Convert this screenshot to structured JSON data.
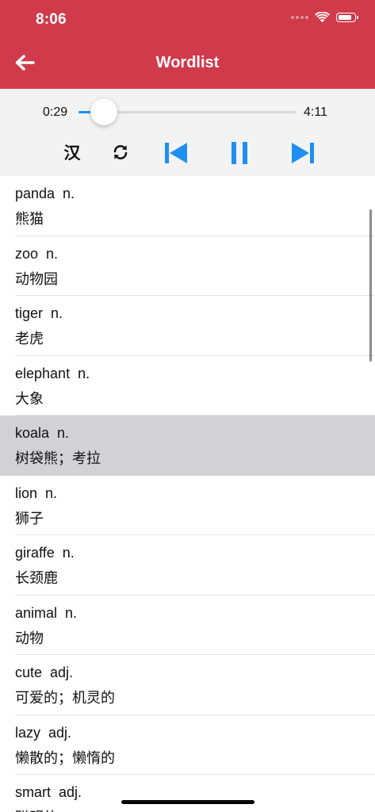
{
  "status_bar": {
    "time": "8:06"
  },
  "nav": {
    "title": "Wordlist",
    "back_icon": "arrow-left-icon"
  },
  "player": {
    "current_time": "0:29",
    "total_time": "4:11",
    "progress": 0.115,
    "chinese_toggle_label": "汉",
    "controls": [
      "repeat-icon",
      "previous-track-icon",
      "pause-icon",
      "next-track-icon"
    ]
  },
  "colors": {
    "header": "#d03a4b",
    "accent": "#1e8ff0",
    "selected_row": "#d1d1d6"
  },
  "words": [
    {
      "en": "panda  n.",
      "zh": "熊猫"
    },
    {
      "en": "zoo  n.",
      "zh": "动物园"
    },
    {
      "en": "tiger  n.",
      "zh": "老虎"
    },
    {
      "en": "elephant  n.",
      "zh": "大象"
    },
    {
      "en": "koala  n.",
      "zh": "树袋熊；考拉",
      "selected": true
    },
    {
      "en": "lion  n.",
      "zh": "狮子"
    },
    {
      "en": "giraffe  n.",
      "zh": "长颈鹿"
    },
    {
      "en": "animal  n.",
      "zh": "动物"
    },
    {
      "en": "cute  adj.",
      "zh": "可爱的；机灵的"
    },
    {
      "en": "lazy  adj.",
      "zh": "懒散的；懒惰的"
    },
    {
      "en": "smart  adj.",
      "zh": "聪明的"
    }
  ]
}
